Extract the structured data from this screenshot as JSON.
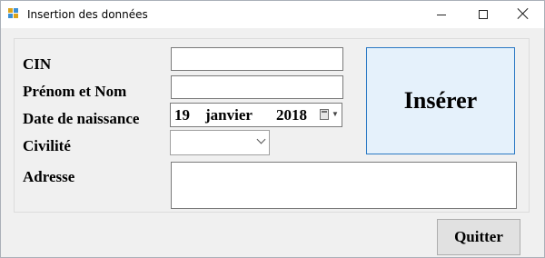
{
  "window": {
    "title": "Insertion des données",
    "controls": {
      "minimize": "—",
      "maximize": "☐",
      "close": "✕"
    }
  },
  "form": {
    "cin_label": "CIN",
    "cin_value": "",
    "prenom_nom_label": "Prénom et Nom",
    "prenom_nom_value": "",
    "date_label": "Date de naissance",
    "date": {
      "day": "19",
      "month": "janvier",
      "year": "2018"
    },
    "civilite_label": "Civilité",
    "civilite_value": "",
    "adresse_label": "Adresse",
    "adresse_value": ""
  },
  "buttons": {
    "insert_label": "Insérer",
    "quit_label": "Quitter"
  },
  "colors": {
    "insert_button_bg": "#e5f1fb",
    "insert_button_border": "#2b79c4",
    "window_bg": "#f0f0f0"
  }
}
